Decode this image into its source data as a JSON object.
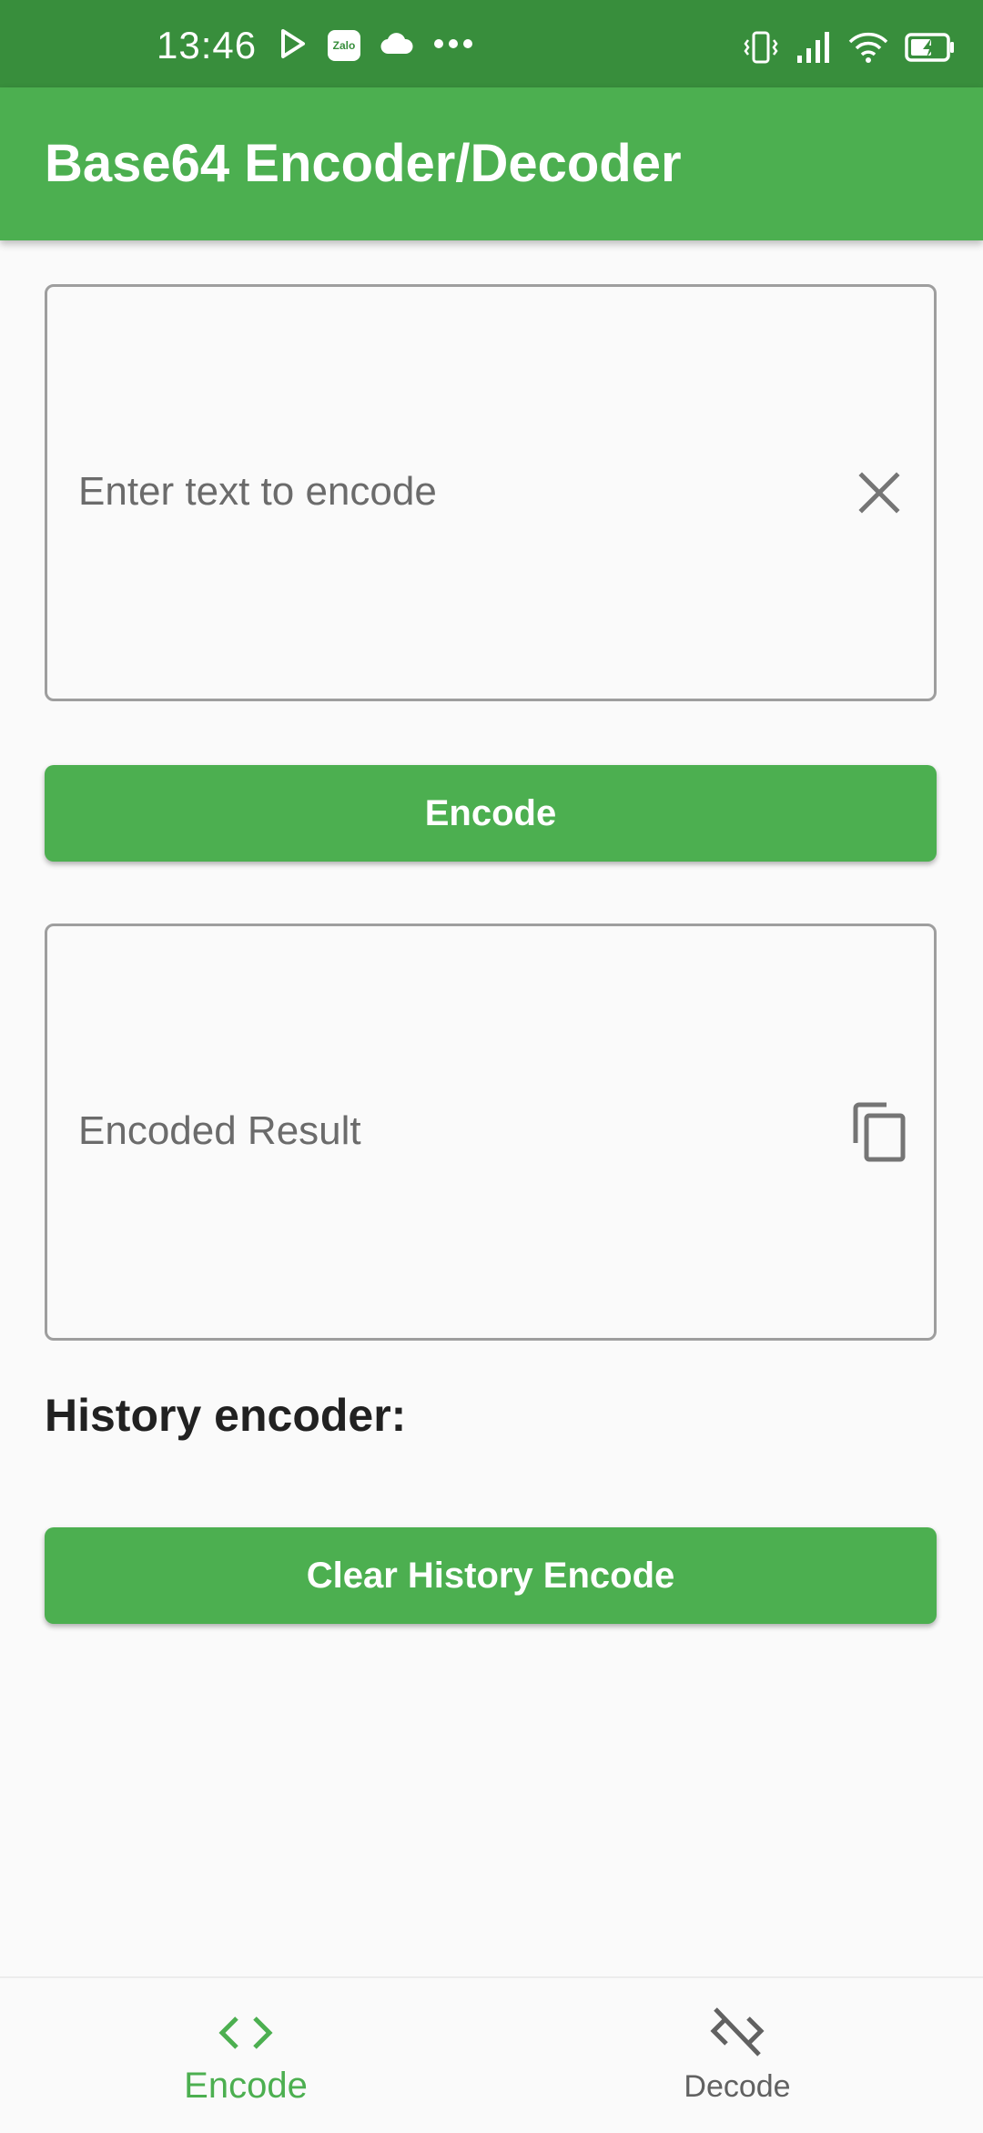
{
  "status_bar": {
    "time": "13:46",
    "left_icons": [
      "play-store-icon",
      "zalo-icon",
      "cloud-icon",
      "more-dots-icon"
    ],
    "zalo_text": "Zalo",
    "right_icons": [
      "vibrate-icon",
      "signal-icon",
      "wifi-icon",
      "battery-charging-icon"
    ]
  },
  "app_bar": {
    "title": "Base64 Encoder/Decoder",
    "color": "#4caf50",
    "status_color": "#388e3c"
  },
  "encode_input": {
    "placeholder": "Enter text to encode",
    "value": "",
    "clear_icon": "close-icon"
  },
  "encode_button": {
    "label": "Encode"
  },
  "result_field": {
    "label": "Encoded Result",
    "copy_icon": "copy-icon"
  },
  "history": {
    "heading": "History encoder:",
    "items": []
  },
  "clear_button": {
    "label": "Clear History Encode"
  },
  "bottom_nav": {
    "items": [
      {
        "label": "Encode",
        "icon": "code-icon",
        "active": true
      },
      {
        "label": "Decode",
        "icon": "code-off-icon",
        "active": false
      }
    ],
    "active_color": "#4caf50",
    "inactive_color": "#616161"
  }
}
